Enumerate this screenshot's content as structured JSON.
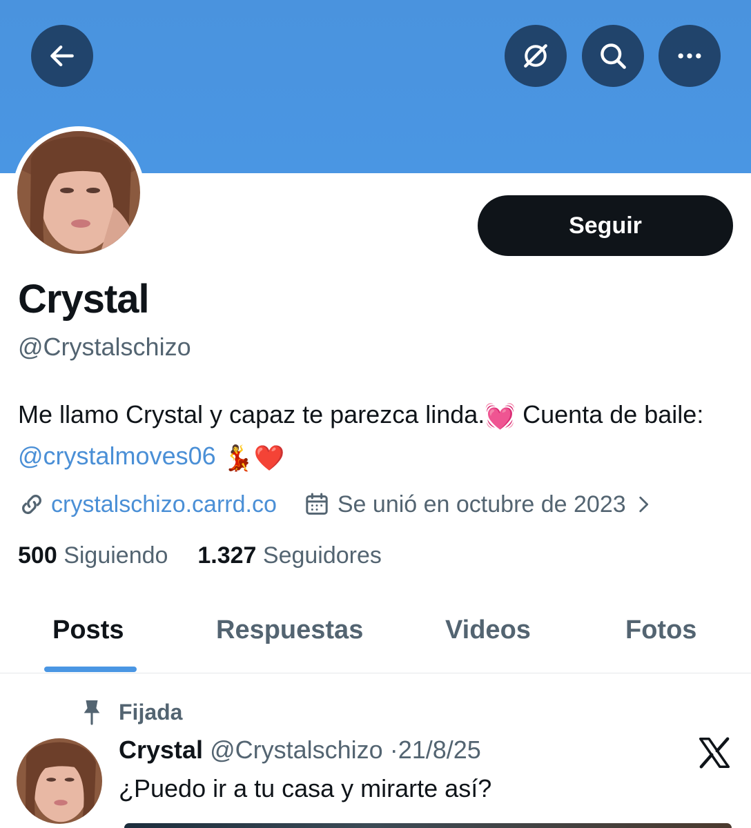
{
  "header": {
    "back_icon": "arrow-left-icon",
    "grok_icon": "grok-icon",
    "search_icon": "search-icon",
    "more_icon": "more-horizontal-icon",
    "banner_color": "#4a93de"
  },
  "profile": {
    "follow_label": "Seguir",
    "name": "Crystal",
    "handle": "@Crystalschizo",
    "bio_text_1": "Me llamo Crystal y capaz te parezca linda.",
    "bio_emoji_1": "💓",
    "bio_text_2": " Cuenta de baile: ",
    "bio_mention": "@crystalmoves06",
    "bio_emoji_2": "💃",
    "bio_emoji_3": "❤️",
    "website": "crystalschizo.carrd.co",
    "joined": "Se unió en octubre de 2023"
  },
  "stats": {
    "following_count": "500",
    "following_label": "Siguiendo",
    "followers_count": "1.327",
    "followers_label": "Seguidores"
  },
  "tabs": [
    {
      "label": "Posts",
      "active": true
    },
    {
      "label": "Respuestas",
      "active": false
    },
    {
      "label": "Videos",
      "active": false
    },
    {
      "label": "Fotos",
      "active": false
    }
  ],
  "pinned_post": {
    "pinned_label": "Fijada",
    "author_name": "Crystal",
    "author_handle": "@Crystalschizo",
    "separator": "·",
    "date": "21/8/25",
    "text": "¿Puedo ir a tu casa y mirarte así?",
    "source_icon": "x-logo-icon"
  },
  "colors": {
    "accent": "#4a96e3",
    "link": "#4a8fd6",
    "text_primary": "#0f1419",
    "text_secondary": "#536471"
  }
}
